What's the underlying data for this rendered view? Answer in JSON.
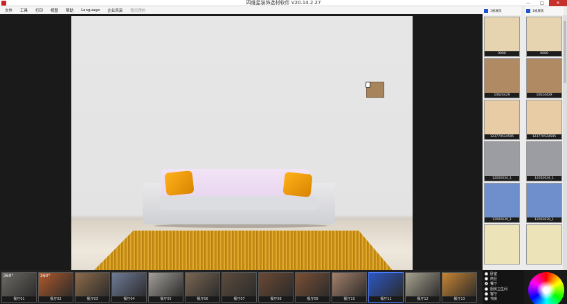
{
  "window": {
    "title": "四维星装饰选材软件 V20.14.2.27",
    "min": "—",
    "max": "□",
    "close": "✕"
  },
  "menu": [
    "文件",
    "工具",
    "打印",
    "视图",
    "帮助",
    "Language",
    "企业风采",
    "我代理的"
  ],
  "right_panel": {
    "columns": [
      {
        "header": "1被展现",
        "tiles": [
          {
            "label": "0000",
            "color": "#e6d4b0"
          },
          {
            "label": "10624429",
            "color": "#b08a63"
          },
          {
            "label": "123770524595",
            "color": "#e7cca5"
          },
          {
            "label": "12002634_1",
            "color": "#9c9da2"
          },
          {
            "label": "12002639_1",
            "color": "#6e8fcc"
          },
          {
            "label": "",
            "color": "#ede3b8"
          }
        ]
      },
      {
        "header": "1被展现",
        "tiles": [
          {
            "label": "0000",
            "color": "#e6d4b0"
          },
          {
            "label": "10624429",
            "color": "#b08a63"
          },
          {
            "label": "123770524595",
            "color": "#e7cca5"
          },
          {
            "label": "12002634_1",
            "color": "#9c9da2"
          },
          {
            "label": "12002639_1",
            "color": "#6e8fcc"
          },
          {
            "label": "",
            "color": "#ede3b8"
          }
        ]
      }
    ]
  },
  "thumbnails": [
    {
      "label": "餐厅01",
      "badge": "360°",
      "color": "#6d6a63"
    },
    {
      "label": "餐厅02",
      "badge": "360°",
      "color": "#b0592a"
    },
    {
      "label": "餐厅03",
      "badge": "",
      "color": "#8d6b4a"
    },
    {
      "label": "餐厅04",
      "badge": "",
      "color": "#6f7b97"
    },
    {
      "label": "餐厅05",
      "badge": "",
      "color": "#a39f98"
    },
    {
      "label": "餐厅06",
      "badge": "",
      "color": "#7a6753"
    },
    {
      "label": "餐厅07",
      "badge": "",
      "color": "#5d4c3e"
    },
    {
      "label": "餐厅08",
      "badge": "",
      "color": "#6b4a33"
    },
    {
      "label": "餐厅09",
      "badge": "",
      "color": "#7b5035"
    },
    {
      "label": "餐厅10",
      "badge": "",
      "color": "#a5806a"
    },
    {
      "label": "餐厅11",
      "badge": "",
      "color": "#2c57c4"
    },
    {
      "label": "餐厅12",
      "badge": "",
      "color": "#a8a391"
    },
    {
      "label": "餐厅13",
      "badge": "",
      "color": "#c98533"
    }
  ],
  "thumbnail_selected": 10,
  "room_types": [
    {
      "label": "卧室",
      "checked": false
    },
    {
      "label": "商业",
      "checked": false
    },
    {
      "label": "餐厅",
      "checked": true
    },
    {
      "label": "厨房卫生间",
      "checked": false
    },
    {
      "label": "客厅",
      "checked": false
    },
    {
      "label": "书房",
      "checked": false
    }
  ],
  "wall_swatch_color": "#a7845c"
}
